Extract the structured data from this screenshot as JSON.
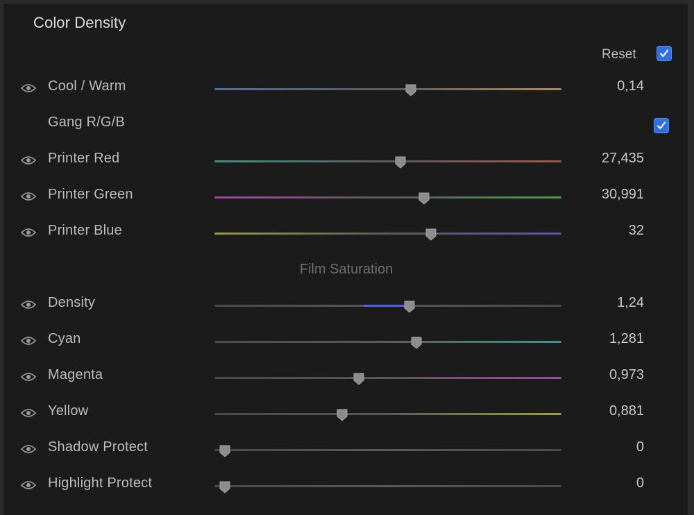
{
  "panel": {
    "title": "Color Density",
    "reset_label": "Reset",
    "section_label": "Film Saturation"
  },
  "rows": [
    {
      "label": "Cool / Warm",
      "value": "0,14",
      "position": 0.565,
      "gradient": [
        "#4f6fa0",
        "#b08a54"
      ]
    },
    {
      "label": "Gang R/G/B",
      "value": ""
    },
    {
      "label": "Printer Red",
      "value": "27,435",
      "position": 0.535,
      "gradient": [
        "#3f8f86",
        "#a25a4c"
      ]
    },
    {
      "label": "Printer Green",
      "value": "30,991",
      "position": 0.603,
      "gradient": [
        "#a04aa0",
        "#4f9a4f"
      ]
    },
    {
      "label": "Printer Blue",
      "value": "32",
      "position": 0.623,
      "gradient": [
        "#9a9a3e",
        "#5a58b0"
      ]
    },
    {
      "label": "Density",
      "value": "1,24",
      "position": 0.561,
      "fill_from": 0.43,
      "gradient": [
        "#4a4a4a",
        "#4a4a4a"
      ]
    },
    {
      "label": "Cyan",
      "value": "1,281",
      "position": 0.582,
      "gradient": [
        "#4a4a4a",
        "#3e9494"
      ]
    },
    {
      "label": "Magenta",
      "value": "0,973",
      "position": 0.415,
      "gradient": [
        "#4a4a4a",
        "#a04a9a"
      ]
    },
    {
      "label": "Yellow",
      "value": "0,881",
      "position": 0.367,
      "gradient": [
        "#4a4a4a",
        "#a0a03a"
      ]
    },
    {
      "label": "Shadow Protect",
      "value": "0",
      "position": 0.03,
      "gradient": [
        "#4a4a4a",
        "#4a4a4a"
      ]
    },
    {
      "label": "Highlight Protect",
      "value": "0",
      "position": 0.03,
      "gradient": [
        "#4a4a4a",
        "#4a4a4a"
      ]
    }
  ],
  "colors": {
    "checkbox": "#2f6fe0",
    "fill": "#5a5ef0"
  }
}
